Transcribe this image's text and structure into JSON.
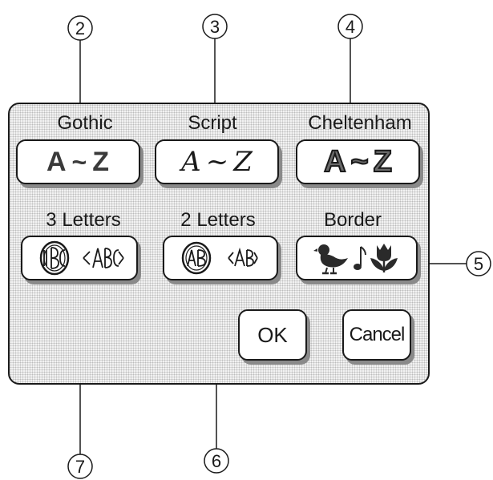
{
  "callouts": {
    "c2": "2",
    "c3": "3",
    "c4": "4",
    "c5": "5",
    "c6": "6",
    "c7": "7"
  },
  "fonts": [
    {
      "label": "Gothic",
      "sample_start": "A",
      "sample_sep": "~",
      "sample_end": "Z"
    },
    {
      "label": "Script",
      "sample_start": "A",
      "sample_sep": "~",
      "sample_end": "Z"
    },
    {
      "label": "Cheltenham",
      "sample_start": "A",
      "sample_sep": "~",
      "sample_end": "Z"
    }
  ],
  "monograms": {
    "three_letters": {
      "label": "3 Letters",
      "icons": [
        "three-letter-monogram-diamond-icon",
        "three-letter-monogram-angled-icon"
      ]
    },
    "two_letters": {
      "label": "2 Letters",
      "icons": [
        "two-letter-monogram-diamond-icon",
        "two-letter-monogram-angled-icon"
      ]
    },
    "border": {
      "label": "Border",
      "icons": [
        "duck-icon",
        "music-note-icon",
        "tulip-icon"
      ]
    }
  },
  "actions": {
    "ok": "OK",
    "cancel": "Cancel"
  },
  "colors": {
    "panel": "#f2f2f2",
    "button": "#ffffff",
    "shadow": "#8a8a8a",
    "ink": "#1a1a1a"
  }
}
